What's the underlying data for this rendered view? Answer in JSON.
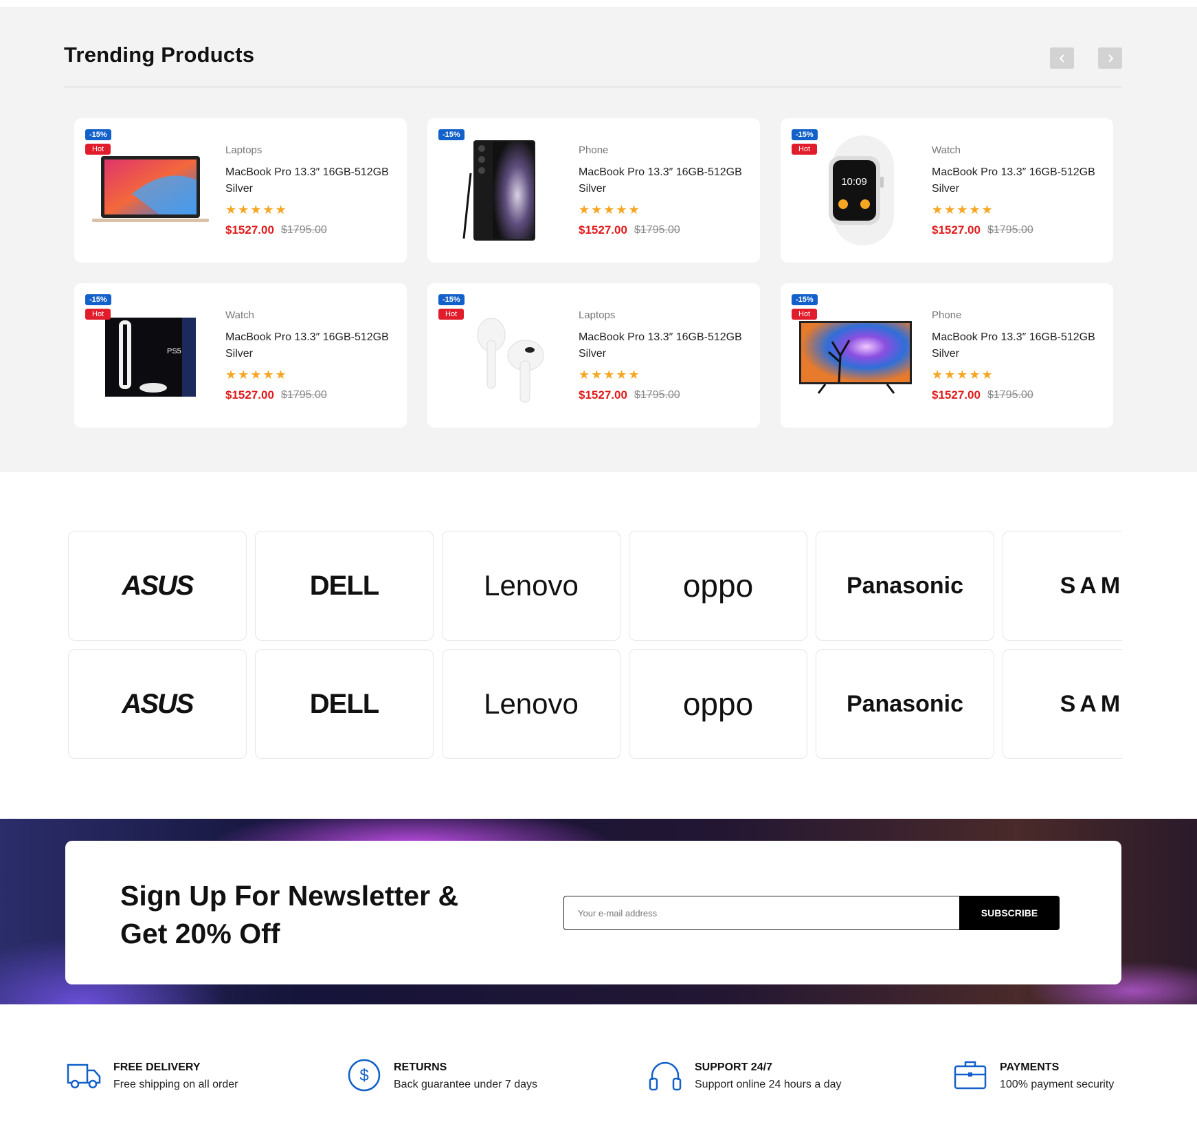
{
  "trending": {
    "title": "Trending Products",
    "prev_icon": "chevron-left-icon",
    "next_icon": "chevron-right-icon",
    "products": [
      {
        "discount": "-15%",
        "hot": "Hot",
        "category": "Laptops",
        "name": "MacBook Pro 13.3″ 16GB-512GB Silver",
        "stars": "★★★★★",
        "price": "$1527.00",
        "old_price": "$1795.00",
        "image": "laptop"
      },
      {
        "discount": "-15%",
        "hot": "",
        "category": "Phone",
        "name": "MacBook Pro 13.3″ 16GB-512GB Silver",
        "stars": "★★★★★",
        "price": "$1527.00",
        "old_price": "$1795.00",
        "image": "phone"
      },
      {
        "discount": "-15%",
        "hot": "Hot",
        "category": "Watch",
        "name": "MacBook Pro 13.3″ 16GB-512GB Silver",
        "stars": "★★★★★",
        "price": "$1527.00",
        "old_price": "$1795.00",
        "image": "watch"
      },
      {
        "discount": "-15%",
        "hot": "Hot",
        "category": "Watch",
        "name": "MacBook Pro 13.3″ 16GB-512GB Silver",
        "stars": "★★★★★",
        "price": "$1527.00",
        "old_price": "$1795.00",
        "image": "console"
      },
      {
        "discount": "-15%",
        "hot": "Hot",
        "category": "Laptops",
        "name": "MacBook Pro 13.3″ 16GB-512GB Silver",
        "stars": "★★★★★",
        "price": "$1527.00",
        "old_price": "$1795.00",
        "image": "earbuds"
      },
      {
        "discount": "-15%",
        "hot": "Hot",
        "category": "Phone",
        "name": "MacBook Pro 13.3″ 16GB-512GB Silver",
        "stars": "★★★★★",
        "price": "$1527.00",
        "old_price": "$1795.00",
        "image": "tv"
      }
    ]
  },
  "brands": {
    "row1": [
      "ASUS",
      "DELL",
      "Lenovo",
      "oppo",
      "Panasonic",
      "SAMSU"
    ],
    "row2": [
      "ASUS",
      "DELL",
      "Lenovo",
      "oppo",
      "Panasonic",
      "SAMSU"
    ]
  },
  "newsletter": {
    "title": "Sign Up For Newsletter & Get 20% Off",
    "placeholder": "Your e-mail address",
    "button": "SUBSCRIBE"
  },
  "features": [
    {
      "icon": "truck-icon",
      "title": "FREE DELIVERY",
      "desc": "Free shipping on all order"
    },
    {
      "icon": "dollar-circle-icon",
      "title": "RETURNS",
      "desc": "Back guarantee under 7 days"
    },
    {
      "icon": "headphones-icon",
      "title": "SUPPORT 24/7",
      "desc": "Support online 24 hours a day"
    },
    {
      "icon": "briefcase-icon",
      "title": "PAYMENTS",
      "desc": "100% payment security"
    }
  ],
  "colors": {
    "accent_blue": "#1260c9",
    "hot_red": "#e21d2b",
    "price_red": "#e01b1b",
    "star": "#f5a623"
  }
}
